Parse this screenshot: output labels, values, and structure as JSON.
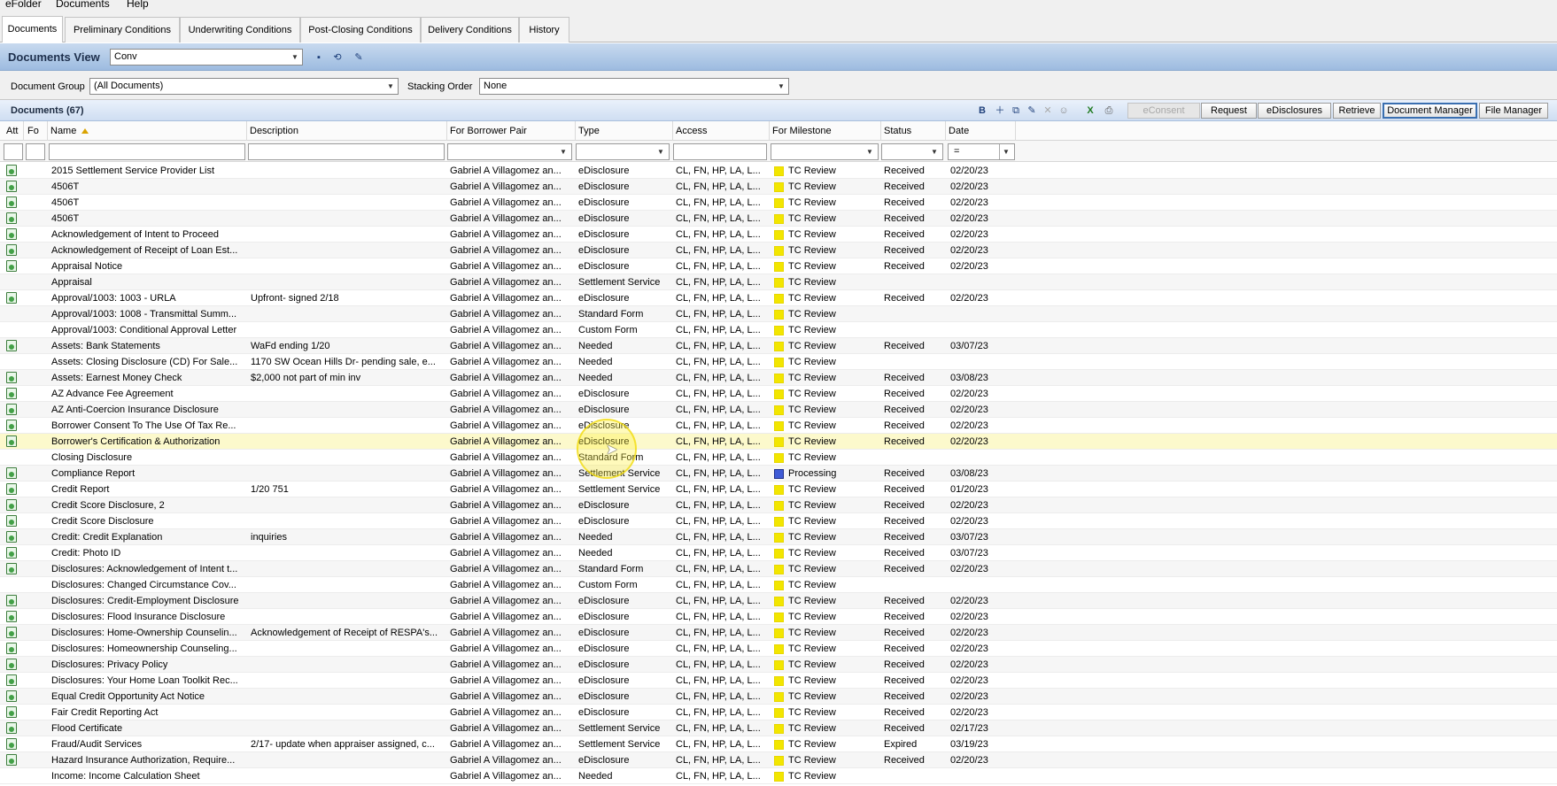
{
  "menu": [
    "eFolder",
    "Documents",
    "Help"
  ],
  "tabs": [
    "Documents",
    "Preliminary Conditions",
    "Underwriting Conditions",
    "Post-Closing Conditions",
    "Delivery Conditions",
    "History"
  ],
  "view": {
    "title": "Documents View",
    "selected": "Conv"
  },
  "group": {
    "label": "Document Group",
    "value": "(All Documents)",
    "stacking_label": "Stacking Order",
    "stacking_value": "None"
  },
  "docs": {
    "count_label": "Documents (67)"
  },
  "buttons": {
    "econsent": "eConsent",
    "request": "Request",
    "edisclosures": "eDisclosures",
    "retrieve": "Retrieve",
    "document_manager": "Document Manager",
    "file_manager": "File Manager"
  },
  "columns": {
    "att": "Att",
    "fo": "Fo",
    "name": "Name",
    "description": "Description",
    "borrower": "For Borrower Pair",
    "type": "Type",
    "access": "Access",
    "milestone": "For Milestone",
    "status": "Status",
    "date": "Date"
  },
  "filter": {
    "date_op": "="
  },
  "colors": {
    "milestone_review": "#f2e600",
    "milestone_processing": "#3f5bd6",
    "highlight_row": "#fcf9cc"
  },
  "rows": [
    {
      "att": true,
      "name": "2015 Settlement Service Provider List",
      "desc": "",
      "borrower": "Gabriel A Villagomez an...",
      "type": "eDisclosure",
      "access": "CL, FN, HP, LA, L...",
      "milestone": "TC Review",
      "status": "Received",
      "date": "02/20/23"
    },
    {
      "att": true,
      "name": "4506T",
      "desc": "",
      "borrower": "Gabriel A Villagomez an...",
      "type": "eDisclosure",
      "access": "CL, FN, HP, LA, L...",
      "milestone": "TC Review",
      "status": "Received",
      "date": "02/20/23"
    },
    {
      "att": true,
      "name": "4506T",
      "desc": "",
      "borrower": "Gabriel A Villagomez an...",
      "type": "eDisclosure",
      "access": "CL, FN, HP, LA, L...",
      "milestone": "TC Review",
      "status": "Received",
      "date": "02/20/23"
    },
    {
      "att": true,
      "name": "4506T",
      "desc": "",
      "borrower": "Gabriel A Villagomez an...",
      "type": "eDisclosure",
      "access": "CL, FN, HP, LA, L...",
      "milestone": "TC Review",
      "status": "Received",
      "date": "02/20/23"
    },
    {
      "att": true,
      "name": "Acknowledgement of Intent to Proceed",
      "desc": "",
      "borrower": "Gabriel A Villagomez an...",
      "type": "eDisclosure",
      "access": "CL, FN, HP, LA, L...",
      "milestone": "TC Review",
      "status": "Received",
      "date": "02/20/23"
    },
    {
      "att": true,
      "name": "Acknowledgement of Receipt of Loan Est...",
      "desc": "",
      "borrower": "Gabriel A Villagomez an...",
      "type": "eDisclosure",
      "access": "CL, FN, HP, LA, L...",
      "milestone": "TC Review",
      "status": "Received",
      "date": "02/20/23"
    },
    {
      "att": true,
      "name": "Appraisal Notice",
      "desc": "",
      "borrower": "Gabriel A Villagomez an...",
      "type": "eDisclosure",
      "access": "CL, FN, HP, LA, L...",
      "milestone": "TC Review",
      "status": "Received",
      "date": "02/20/23"
    },
    {
      "att": false,
      "name": "Appraisal",
      "desc": "",
      "borrower": "Gabriel A Villagomez an...",
      "type": "Settlement Service",
      "access": "CL, FN, HP, LA, L...",
      "milestone": "TC Review",
      "status": "",
      "date": ""
    },
    {
      "att": true,
      "name": "Approval/1003: 1003 - URLA",
      "desc": "Upfront- signed 2/18",
      "borrower": "Gabriel A Villagomez an...",
      "type": "eDisclosure",
      "access": "CL, FN, HP, LA, L...",
      "milestone": "TC Review",
      "status": "Received",
      "date": "02/20/23"
    },
    {
      "att": false,
      "name": "Approval/1003: 1008 - Transmittal Summ...",
      "desc": "",
      "borrower": "Gabriel A Villagomez an...",
      "type": "Standard Form",
      "access": "CL, FN, HP, LA, L...",
      "milestone": "TC Review",
      "status": "",
      "date": ""
    },
    {
      "att": false,
      "name": "Approval/1003: Conditional Approval Letter",
      "desc": "",
      "borrower": "Gabriel A Villagomez an...",
      "type": "Custom Form",
      "access": "CL, FN, HP, LA, L...",
      "milestone": "TC Review",
      "status": "",
      "date": ""
    },
    {
      "att": true,
      "name": "Assets: Bank Statements",
      "desc": "WaFd ending 1/20",
      "borrower": "Gabriel A Villagomez an...",
      "type": "Needed",
      "access": "CL, FN, HP, LA, L...",
      "milestone": "TC Review",
      "status": "Received",
      "date": "03/07/23"
    },
    {
      "att": false,
      "name": "Assets: Closing Disclosure (CD) For Sale...",
      "desc": "1170 SW Ocean Hills Dr- pending sale, e...",
      "borrower": "Gabriel A Villagomez an...",
      "type": "Needed",
      "access": "CL, FN, HP, LA, L...",
      "milestone": "TC Review",
      "status": "",
      "date": ""
    },
    {
      "att": true,
      "name": "Assets: Earnest Money Check",
      "desc": "$2,000 not part of min inv",
      "borrower": "Gabriel A Villagomez an...",
      "type": "Needed",
      "access": "CL, FN, HP, LA, L...",
      "milestone": "TC Review",
      "status": "Received",
      "date": "03/08/23"
    },
    {
      "att": true,
      "name": "AZ Advance Fee Agreement",
      "desc": "",
      "borrower": "Gabriel A Villagomez an...",
      "type": "eDisclosure",
      "access": "CL, FN, HP, LA, L...",
      "milestone": "TC Review",
      "status": "Received",
      "date": "02/20/23"
    },
    {
      "att": true,
      "name": "AZ Anti-Coercion Insurance Disclosure",
      "desc": "",
      "borrower": "Gabriel A Villagomez an...",
      "type": "eDisclosure",
      "access": "CL, FN, HP, LA, L...",
      "milestone": "TC Review",
      "status": "Received",
      "date": "02/20/23"
    },
    {
      "att": true,
      "name": "Borrower Consent To The Use Of Tax Re...",
      "desc": "",
      "borrower": "Gabriel A Villagomez an...",
      "type": "eDisclosure",
      "access": "CL, FN, HP, LA, L...",
      "milestone": "TC Review",
      "status": "Received",
      "date": "02/20/23"
    },
    {
      "att": true,
      "name": "Borrower's Certification & Authorization",
      "desc": "",
      "borrower": "Gabriel A Villagomez an...",
      "type": "eDisclosure",
      "access": "CL, FN, HP, LA, L...",
      "milestone": "TC Review",
      "status": "Received",
      "date": "02/20/23",
      "highlight": true
    },
    {
      "att": false,
      "name": "Closing Disclosure",
      "desc": "",
      "borrower": "Gabriel A Villagomez an...",
      "type": "Standard Form",
      "access": "CL, FN, HP, LA, L...",
      "milestone": "TC Review",
      "status": "",
      "date": ""
    },
    {
      "att": true,
      "name": "Compliance Report",
      "desc": "",
      "borrower": "Gabriel A Villagomez an...",
      "type": "Settlement Service",
      "access": "CL, FN, HP, LA, L...",
      "milestone": "Processing",
      "status": "Received",
      "date": "03/08/23"
    },
    {
      "att": true,
      "name": "Credit Report",
      "desc": "1/20  751",
      "borrower": "Gabriel A Villagomez an...",
      "type": "Settlement Service",
      "access": "CL, FN, HP, LA, L...",
      "milestone": "TC Review",
      "status": "Received",
      "date": "01/20/23"
    },
    {
      "att": true,
      "name": "Credit Score Disclosure, 2",
      "desc": "",
      "borrower": "Gabriel A Villagomez an...",
      "type": "eDisclosure",
      "access": "CL, FN, HP, LA, L...",
      "milestone": "TC Review",
      "status": "Received",
      "date": "02/20/23"
    },
    {
      "att": true,
      "name": "Credit Score Disclosure",
      "desc": "",
      "borrower": "Gabriel A Villagomez an...",
      "type": "eDisclosure",
      "access": "CL, FN, HP, LA, L...",
      "milestone": "TC Review",
      "status": "Received",
      "date": "02/20/23"
    },
    {
      "att": true,
      "name": "Credit: Credit Explanation",
      "desc": "inquiries",
      "borrower": "Gabriel A Villagomez an...",
      "type": "Needed",
      "access": "CL, FN, HP, LA, L...",
      "milestone": "TC Review",
      "status": "Received",
      "date": "03/07/23"
    },
    {
      "att": true,
      "name": "Credit: Photo ID",
      "desc": "",
      "borrower": "Gabriel A Villagomez an...",
      "type": "Needed",
      "access": "CL, FN, HP, LA, L...",
      "milestone": "TC Review",
      "status": "Received",
      "date": "03/07/23"
    },
    {
      "att": true,
      "name": "Disclosures: Acknowledgement of Intent t...",
      "desc": "",
      "borrower": "Gabriel A Villagomez an...",
      "type": "Standard Form",
      "access": "CL, FN, HP, LA, L...",
      "milestone": "TC Review",
      "status": "Received",
      "date": "02/20/23"
    },
    {
      "att": false,
      "name": "Disclosures: Changed Circumstance Cov...",
      "desc": "",
      "borrower": "Gabriel A Villagomez an...",
      "type": "Custom Form",
      "access": "CL, FN, HP, LA, L...",
      "milestone": "TC Review",
      "status": "",
      "date": ""
    },
    {
      "att": true,
      "name": "Disclosures: Credit-Employment Disclosure",
      "desc": "",
      "borrower": "Gabriel A Villagomez an...",
      "type": "eDisclosure",
      "access": "CL, FN, HP, LA, L...",
      "milestone": "TC Review",
      "status": "Received",
      "date": "02/20/23"
    },
    {
      "att": true,
      "name": "Disclosures: Flood Insurance Disclosure",
      "desc": "",
      "borrower": "Gabriel A Villagomez an...",
      "type": "eDisclosure",
      "access": "CL, FN, HP, LA, L...",
      "milestone": "TC Review",
      "status": "Received",
      "date": "02/20/23"
    },
    {
      "att": true,
      "name": "Disclosures: Home-Ownership Counselin...",
      "desc": "Acknowledgement of Receipt of RESPA's...",
      "borrower": "Gabriel A Villagomez an...",
      "type": "eDisclosure",
      "access": "CL, FN, HP, LA, L...",
      "milestone": "TC Review",
      "status": "Received",
      "date": "02/20/23"
    },
    {
      "att": true,
      "name": "Disclosures: Homeownership Counseling...",
      "desc": "",
      "borrower": "Gabriel A Villagomez an...",
      "type": "eDisclosure",
      "access": "CL, FN, HP, LA, L...",
      "milestone": "TC Review",
      "status": "Received",
      "date": "02/20/23"
    },
    {
      "att": true,
      "name": "Disclosures: Privacy Policy",
      "desc": "",
      "borrower": "Gabriel A Villagomez an...",
      "type": "eDisclosure",
      "access": "CL, FN, HP, LA, L...",
      "milestone": "TC Review",
      "status": "Received",
      "date": "02/20/23"
    },
    {
      "att": true,
      "name": "Disclosures: Your Home Loan Toolkit Rec...",
      "desc": "",
      "borrower": "Gabriel A Villagomez an...",
      "type": "eDisclosure",
      "access": "CL, FN, HP, LA, L...",
      "milestone": "TC Review",
      "status": "Received",
      "date": "02/20/23"
    },
    {
      "att": true,
      "name": "Equal Credit Opportunity Act Notice",
      "desc": "",
      "borrower": "Gabriel A Villagomez an...",
      "type": "eDisclosure",
      "access": "CL, FN, HP, LA, L...",
      "milestone": "TC Review",
      "status": "Received",
      "date": "02/20/23"
    },
    {
      "att": true,
      "name": "Fair Credit Reporting Act",
      "desc": "",
      "borrower": "Gabriel A Villagomez an...",
      "type": "eDisclosure",
      "access": "CL, FN, HP, LA, L...",
      "milestone": "TC Review",
      "status": "Received",
      "date": "02/20/23"
    },
    {
      "att": true,
      "name": "Flood Certificate",
      "desc": "",
      "borrower": "Gabriel A Villagomez an...",
      "type": "Settlement Service",
      "access": "CL, FN, HP, LA, L...",
      "milestone": "TC Review",
      "status": "Received",
      "date": "02/17/23"
    },
    {
      "att": true,
      "name": "Fraud/Audit Services",
      "desc": "2/17- update when appraiser assigned, c...",
      "borrower": "Gabriel A Villagomez an...",
      "type": "Settlement Service",
      "access": "CL, FN, HP, LA, L...",
      "milestone": "TC Review",
      "status": "Expired",
      "date": "03/19/23"
    },
    {
      "att": true,
      "name": "Hazard Insurance Authorization, Require...",
      "desc": "",
      "borrower": "Gabriel A Villagomez an...",
      "type": "eDisclosure",
      "access": "CL, FN, HP, LA, L...",
      "milestone": "TC Review",
      "status": "Received",
      "date": "02/20/23"
    },
    {
      "att": false,
      "name": "Income: Income Calculation Sheet",
      "desc": "",
      "borrower": "Gabriel A Villagomez an...",
      "type": "Needed",
      "access": "CL, FN, HP, LA, L...",
      "milestone": "TC Review",
      "status": "",
      "date": ""
    }
  ]
}
